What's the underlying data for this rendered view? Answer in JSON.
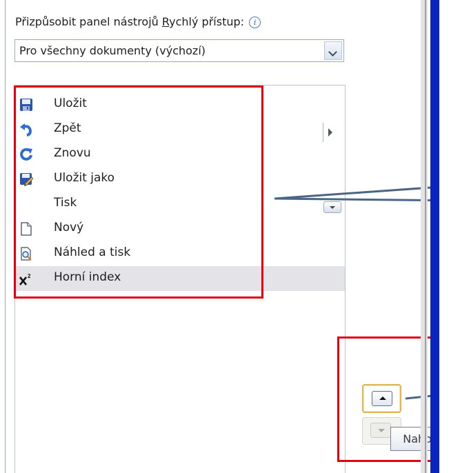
{
  "customize": {
    "label_prefix": "Přizpůsobit panel nástrojů ",
    "label_underlined": "R",
    "label_suffix": "ychlý přístup:",
    "scope_combo_value": "Pro všechny dokumenty (výchozí)"
  },
  "quick_access_items": [
    {
      "label": "Uložit",
      "icon": "save-icon"
    },
    {
      "label": "Zpět",
      "icon": "undo-icon"
    },
    {
      "label": "Znovu",
      "icon": "redo-icon"
    },
    {
      "label": "Uložit jako",
      "icon": "save-as-icon"
    },
    {
      "label": "Tisk",
      "icon": ""
    },
    {
      "label": "Nový",
      "icon": "new-document-icon"
    },
    {
      "label": "Náhled a tisk",
      "icon": "print-preview-icon"
    },
    {
      "label": "Horní index",
      "icon": "superscript-icon",
      "selected": true
    }
  ],
  "tooltip": "Nahoru",
  "colors": {
    "callout": "#e00012",
    "selection": "#e4e4e8",
    "arrow_line": "#4b6584",
    "accent_bar": "#0a24c0"
  }
}
